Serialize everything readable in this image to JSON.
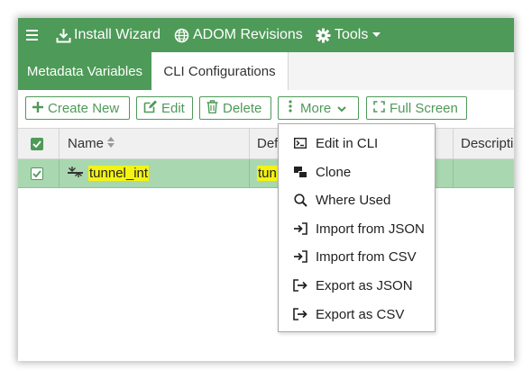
{
  "topbar": {
    "install_wizard": "Install Wizard",
    "adom_revisions": "ADOM Revisions",
    "tools": "Tools"
  },
  "tabs": {
    "metadata_variables": "Metadata Variables",
    "cli_configurations": "CLI Configurations"
  },
  "toolbar": {
    "create_new": "Create New",
    "edit": "Edit",
    "delete": "Delete",
    "more": "More",
    "full_screen": "Full Screen"
  },
  "table": {
    "columns": {
      "name": "Name",
      "default_partial": "Def",
      "description_partial": "Descripti"
    },
    "rows": [
      {
        "name": "tunnel_int",
        "default_partial": "tun",
        "checked": true
      }
    ]
  },
  "more_menu": {
    "items": [
      {
        "label": "Edit in CLI",
        "icon": "terminal-icon"
      },
      {
        "label": "Clone",
        "icon": "clone-icon"
      },
      {
        "label": "Where Used",
        "icon": "search-icon"
      },
      {
        "label": "Import from JSON",
        "icon": "import-icon"
      },
      {
        "label": "Import from CSV",
        "icon": "import-icon"
      },
      {
        "label": "Export as JSON",
        "icon": "export-icon"
      },
      {
        "label": "Export as CSV",
        "icon": "export-icon"
      }
    ]
  },
  "colors": {
    "brand_green": "#4e9a58",
    "selected_row": "#a9d8b0",
    "highlight": "#f4f312"
  }
}
